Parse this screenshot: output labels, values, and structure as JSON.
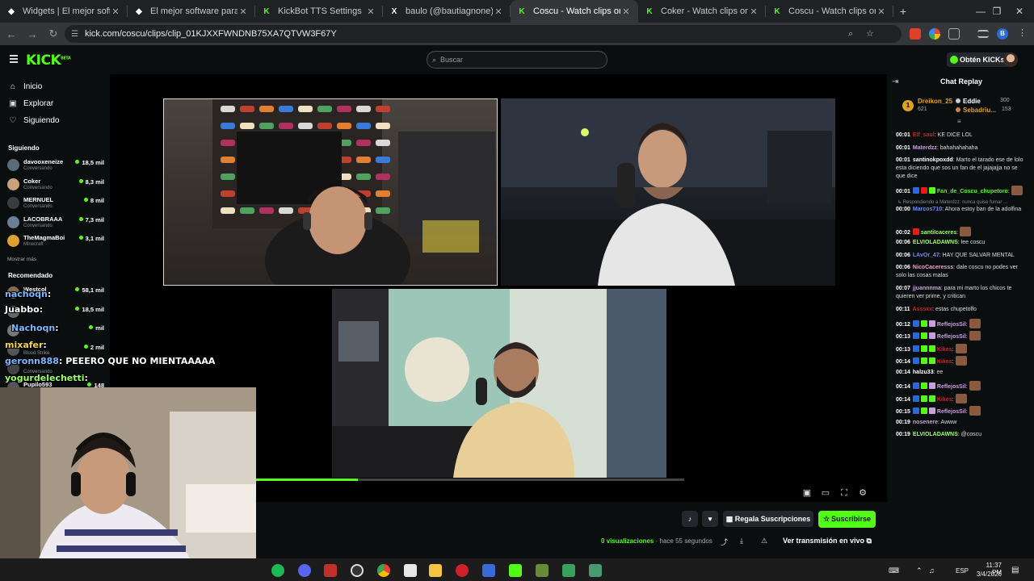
{
  "browser": {
    "tabs": [
      {
        "title": "Widgets | El mejor software para",
        "fav_color": "#ffffff",
        "fav_glyph": "◆"
      },
      {
        "title": "El mejor software para potencia",
        "fav_color": "#ffffff",
        "fav_glyph": "◆"
      },
      {
        "title": "KickBot TTS Settings",
        "fav_color": "#53fc18",
        "fav_glyph": "K"
      },
      {
        "title": "baulo (@bautiagnone) / X",
        "fav_color": "#ffffff",
        "fav_glyph": "X"
      },
      {
        "title": "Coscu - Watch clips on Kick",
        "fav_color": "#53fc18",
        "fav_glyph": "K",
        "active": true
      },
      {
        "title": "Coker - Watch clips on Kick",
        "fav_color": "#53fc18",
        "fav_glyph": "K"
      },
      {
        "title": "Coscu - Watch clips on Kick",
        "fav_color": "#53fc18",
        "fav_glyph": "K"
      }
    ],
    "url": "kick.com/coscu/clips/clip_01KJXXFWNDNB75XA7QTVW3F67Y",
    "profile_initial": "B"
  },
  "kick": {
    "search_placeholder": "Buscar",
    "get_kicks": "Obtén KICKs",
    "logo_text": "KICK",
    "logo_sup": "BETA",
    "nav": {
      "home": "Inicio",
      "explore": "Explorar",
      "following": "Siguiendo"
    },
    "following_heading": "Siguiendo",
    "following": [
      {
        "name": "davooxeneize",
        "category": "Conversando",
        "viewers": "18,5 mil",
        "color": "#5a6b7a"
      },
      {
        "name": "Coker",
        "category": "Conversando",
        "viewers": "8,3 mil",
        "color": "#c9a27a"
      },
      {
        "name": "MERNUEL",
        "category": "Conversando",
        "viewers": "8 mil",
        "color": "#3c3c3c"
      },
      {
        "name": "LACOBRAAA",
        "category": "Conversando",
        "viewers": "7,3 mil",
        "color": "#6a7f98"
      },
      {
        "name": "TheMagmaBoi",
        "category": "Minecraft",
        "viewers": "3,1 mil",
        "color": "#e0a030"
      }
    ],
    "show_more": "Mostrar más",
    "recommended_heading": "Recomendado",
    "recommended": [
      {
        "name": "Westcol",
        "category": "",
        "viewers": "58,1 mil",
        "color": "#8a6a4a"
      },
      {
        "name": "",
        "category": "",
        "viewers": "18,5 mil",
        "color": "#666"
      },
      {
        "name": "",
        "category": "",
        "viewers": "mil",
        "color": "#777"
      },
      {
        "name": "",
        "category": "Blood Strike",
        "viewers": "2 mil",
        "color": "#555"
      },
      {
        "name": "",
        "category": "Conversando",
        "viewers": "",
        "color": "#444"
      },
      {
        "name": "Pupilo593",
        "category": "",
        "viewers": "148",
        "color": "#555"
      }
    ],
    "chat_title": "Chat Replay",
    "leaderboard": {
      "rank": "1",
      "first": {
        "name": "Dreikon_25",
        "value": "621"
      },
      "second": {
        "name": "Eddie",
        "value": "300"
      },
      "third": {
        "name": "Sebadriu...",
        "value": "153"
      }
    },
    "chat": [
      {
        "ts": "00:01",
        "user": "Elf_saul",
        "text": ": KE DICE LOL",
        "color": "#e91916",
        "badges": []
      },
      {
        "ts": "00:01",
        "user": "Materdzz",
        "text": ": bahahahahaha",
        "color": "#c9a0dc",
        "badges": []
      },
      {
        "ts": "00:01",
        "user": "santinokpoxdd",
        "text": ": Marto el tarado ese de lolo esta diciendo que sos un fan de el jajajajja no se que dice",
        "color": "#ffffff",
        "badges": []
      },
      {
        "ts": "00:01",
        "user": "Fan_de_Coscu_chupetoro",
        "text": ":",
        "color": "#53fc18",
        "badges": [
          "#2a6ad8",
          "#e91916",
          "#53fc18"
        ]
      },
      {
        "ts": "",
        "user": "",
        "text": "↳ Respondiendo a Materdzz: nunca quise fumar ...",
        "color": "#888",
        "badges": [],
        "reply": true
      },
      {
        "ts": "00:00",
        "user": "Marcos710",
        "text": ": Ahora estoy ban de la adolfina",
        "color": "#6a8cff",
        "badges": []
      },
      {
        "ts": "00:02",
        "user": "santiIcaceres",
        "text": ":",
        "color": "#9bff6a",
        "badges": [
          "#e91916"
        ]
      },
      {
        "ts": "00:06",
        "user": "ELVIOLADAWNS",
        "text": ": lee coscu",
        "color": "#9bff6a",
        "badges": []
      },
      {
        "ts": "00:06",
        "user": "LAvOr_47",
        "text": ": HAY QUE SALVAR MENTAL",
        "color": "#6a8cff",
        "badges": []
      },
      {
        "ts": "00:06",
        "user": "NicoCaceresss",
        "text": ": dale coscu no podes ver solo las cosas malas",
        "color": "#f0a0d0",
        "badges": []
      },
      {
        "ts": "00:07",
        "user": "jjuannnma",
        "text": ": para mi marto los chicos te quieren ver prime, y critican",
        "color": "#c9a0dc",
        "badges": []
      },
      {
        "ts": "00:11",
        "user": "Asssxx",
        "text": ": estas chupetolfo",
        "color": "#e91916",
        "badges": []
      },
      {
        "ts": "00:12",
        "user": "ReflejosSil",
        "text": ":",
        "color": "#c9a0dc",
        "badges": [
          "#2a6ad8",
          "#53fc18",
          "#c9a0dc"
        ]
      },
      {
        "ts": "00:13",
        "user": "ReflejosSil",
        "text": ":",
        "color": "#c9a0dc",
        "badges": [
          "#2a6ad8",
          "#53fc18",
          "#c9a0dc"
        ]
      },
      {
        "ts": "00:13",
        "user": "Kikes",
        "text": ":",
        "color": "#e91916",
        "badges": [
          "#2a6ad8",
          "#53fc18",
          "#53fc18"
        ]
      },
      {
        "ts": "00:14",
        "user": "Kikes",
        "text": ":",
        "color": "#e91916",
        "badges": [
          "#2a6ad8",
          "#53fc18",
          "#53fc18"
        ]
      },
      {
        "ts": "00:14",
        "user": "halzu33",
        "text": ": ee",
        "color": "#ffffff",
        "badges": []
      },
      {
        "ts": "00:14",
        "user": "ReflejosSil",
        "text": ":",
        "color": "#c9a0dc",
        "badges": [
          "#2a6ad8",
          "#53fc18",
          "#c9a0dc"
        ]
      },
      {
        "ts": "00:14",
        "user": "Kikes",
        "text": ":",
        "color": "#e91916",
        "badges": [
          "#2a6ad8",
          "#53fc18",
          "#53fc18"
        ]
      },
      {
        "ts": "00:15",
        "user": "ReflejosSil",
        "text": ":",
        "color": "#c9a0dc",
        "badges": [
          "#2a6ad8",
          "#53fc18",
          "#c9a0dc"
        ]
      },
      {
        "ts": "00:19",
        "user": "nosenere",
        "text": ": Awww",
        "color": "#c9a0dc",
        "badges": []
      },
      {
        "ts": "00:19",
        "user": "ELVIOLADAWNS",
        "text": ": @coscu",
        "color": "#9bff6a",
        "badges": []
      }
    ],
    "actions": {
      "gift_subs": "Regala Suscripciones",
      "subscribe": "Suscribirse",
      "views": "0 visualizaciones",
      "time_ago": "· hace 55 segundos",
      "watch_live": "Ver transmisión en vivo"
    },
    "progress": 0.24
  },
  "overlay_chat": [
    {
      "user": "nachoqn",
      "text": "",
      "color": "#7ab8ff"
    },
    {
      "user": "Juabbo",
      "text": "",
      "color": "#ffffff"
    },
    {
      "user": "Nachoqn",
      "text": "",
      "color": "#7ab8ff"
    },
    {
      "user": "mixafer",
      "text": "",
      "color": "#f5d742"
    },
    {
      "user": "geronn888",
      "text": "PEEERO QUE NO MIENTAAAAA",
      "color": "#7ab8ff"
    },
    {
      "user": "yogurdelechetti",
      "text": "",
      "color": "#9bff6a"
    }
  ],
  "taskbar": {
    "time": "11:37 PM",
    "date": "3/4/2026",
    "lang": "ESP"
  }
}
